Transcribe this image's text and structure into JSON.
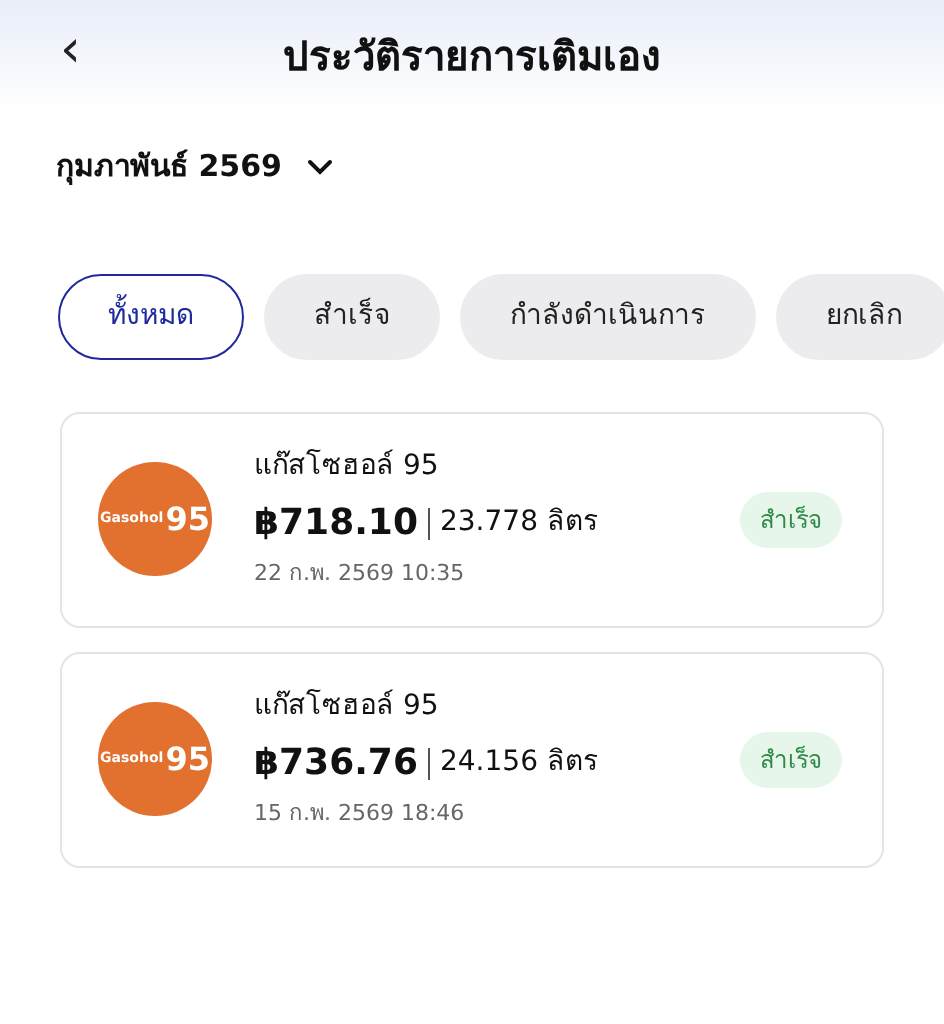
{
  "header": {
    "back": "‹",
    "title": "ประวัติรายการเติมเอง"
  },
  "month": {
    "label": "กุมภาพันธ์ 2569"
  },
  "filters": [
    {
      "label": "ทั้งหมด",
      "selected": true
    },
    {
      "label": "สำเร็จ",
      "selected": false
    },
    {
      "label": "กำลังดำเนินการ",
      "selected": false
    },
    {
      "label": "ยกเลิก",
      "selected": false
    }
  ],
  "transactions": [
    {
      "logo": {
        "brand": "Gasohol",
        "grade": "95"
      },
      "fuel": "แก๊สโซฮอล์ 95",
      "amount": "฿718.10",
      "volume": "23.778 ลิตร",
      "datetime": "22 ก.พ. 2569 10:35",
      "status": "สำเร็จ"
    },
    {
      "logo": {
        "brand": "Gasohol",
        "grade": "95"
      },
      "fuel": "แก๊สโซฮอล์ 95",
      "amount": "฿736.76",
      "volume": "24.156 ลิตร",
      "datetime": "15 ก.พ. 2569 18:46",
      "status": "สำเร็จ"
    }
  ]
}
